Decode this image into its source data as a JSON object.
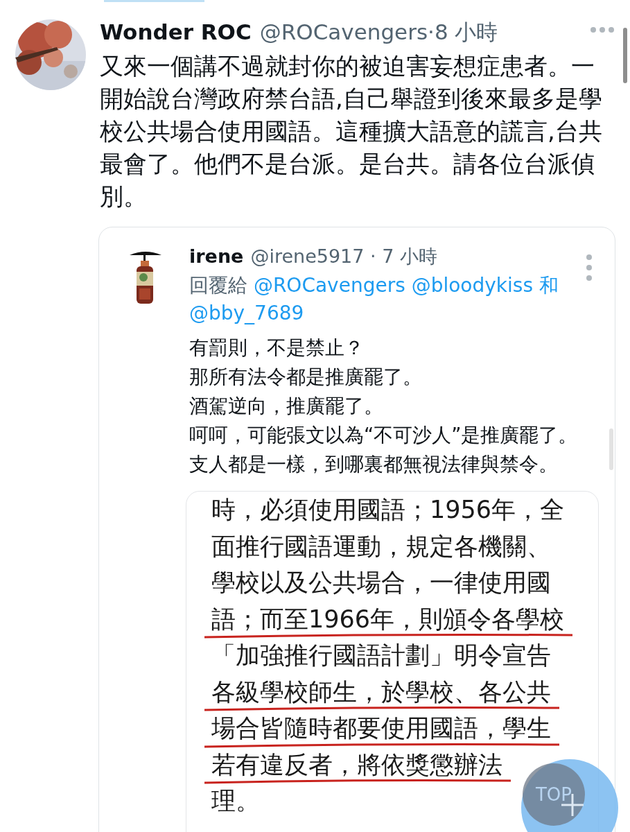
{
  "tweet": {
    "author": {
      "name": "Wonder ROC",
      "meta": "@ROCavengers·8 小時"
    },
    "text": "又來一個講不過就封你的被迫害妄想症患者。一開始說台灣政府禁台語,自己舉證到後來最多是學校公共場合使用國語。這種擴大語意的謊言,台共最會了。他們不是台派。是台共。請各位台派偵別。",
    "quote": {
      "author": {
        "name": "irene",
        "meta": "@irene5917 · 7 小時"
      },
      "reply": {
        "prefix": "回覆給",
        "mentions": [
          "@ROCavengers",
          "@bloodykiss"
        ],
        "conjunction": "和",
        "last": "@bby_7689"
      },
      "lines": [
        "有罰則，不是禁止？",
        "那所有法令都是推廣罷了。",
        "酒駕逆向，推廣罷了。",
        "呵呵，可能張文以為“不可沙人”是推廣罷了。",
        "支人都是一樣，到哪裏都無視法律與禁令。"
      ],
      "document": [
        {
          "text": "時，必須使用國語；1956年，全",
          "underlined": false
        },
        {
          "text": "面推行國語運動，規定各機關、",
          "underlined": false
        },
        {
          "text": "學校以及公共場合，一律使用國",
          "underlined": false
        },
        {
          "text": "語；而至1966年，則頒令各學校",
          "underlined": true
        },
        {
          "text": "「加強推行國語計劃」明令宣告",
          "underlined": false
        },
        {
          "text": "各級學校師生，於學校、各公共",
          "underlined": true
        },
        {
          "text": "場合皆隨時都要使用國語，學生",
          "underlined": true
        },
        {
          "text": "若有違反者，將依獎懲辦法",
          "underlined": true
        },
        {
          "text": "理。",
          "underlined": false
        }
      ]
    }
  },
  "top_button": {
    "label": "TOP"
  }
}
